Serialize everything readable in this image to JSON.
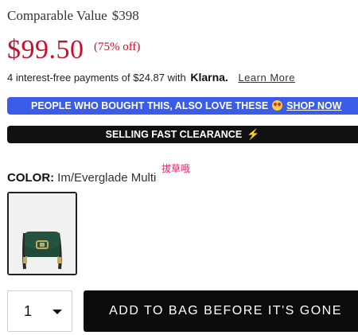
{
  "pricing": {
    "comparable_label": "Comparable Value",
    "comparable_price": "$398",
    "price": "$99.50",
    "discount": "(75% off)"
  },
  "installments": {
    "text": "4 interest-free payments of $24.87 with",
    "provider": "Klarna.",
    "learn_more": "Learn More"
  },
  "promo_banner": {
    "text": "PEOPLE WHO BOUGHT THIS, ALSO LOVE THESE",
    "emoji_icon": "heart-eyes-emoji",
    "link_text": "SHOP NOW",
    "background": "#3b5ce8"
  },
  "clearance_banner": {
    "text": "SELLING FAST CLEARANCE",
    "icon": "lightning-bolt",
    "background": "#111111",
    "icon_color": "#f6a623"
  },
  "overlay_text": "拔草哦",
  "color": {
    "label": "COLOR:",
    "value": "Im/Everglade Multi",
    "swatches": [
      {
        "name": "Im/Everglade Multi",
        "selected": true,
        "bag_color": "#1f4a38"
      }
    ]
  },
  "quantity": {
    "value": "1"
  },
  "add_to_bag": {
    "label": "ADD TO BAG BEFORE IT'S GONE"
  },
  "colors": {
    "sale_red": "#c8102e",
    "accent_pink": "#e8256d"
  }
}
